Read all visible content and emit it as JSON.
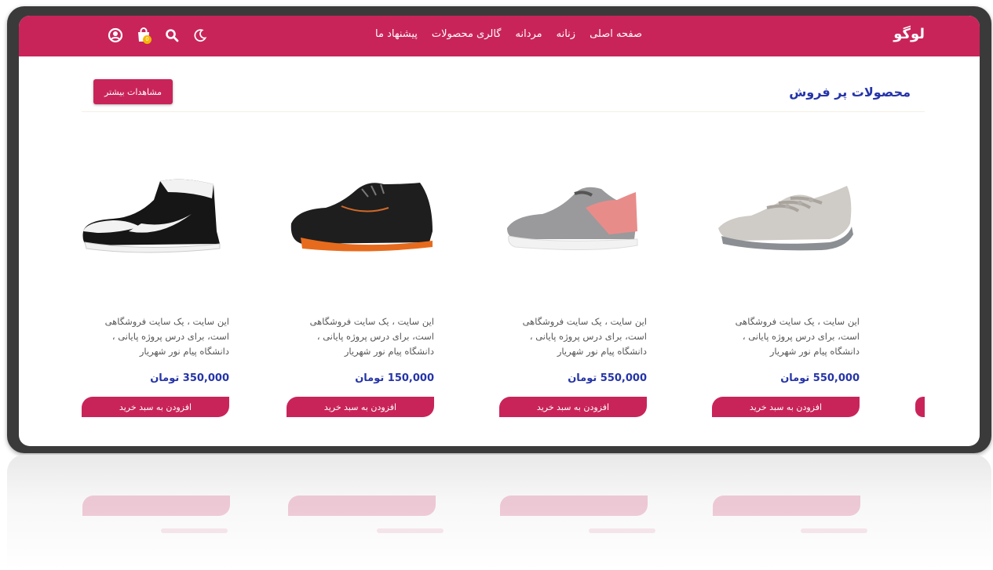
{
  "nav": {
    "logo": "لوگو",
    "links": [
      "صفحه اصلی",
      "زنانه",
      "مردانه",
      "گالری محصولات",
      "پیشنهاد ما"
    ],
    "icons": [
      "account-icon",
      "cart-icon",
      "search-icon",
      "dark-mode-icon"
    ],
    "cart_count": "0",
    "bg_color": "#c9245a"
  },
  "section": {
    "title": "محصولات پر فروش",
    "more_label": "مشاهدات بیشتر"
  },
  "products": [
    {
      "description": "این سایت ، یک سایت فروشگاهی است، برای درس پروژه پایانی ، دانشگاه پیام نور شهریار",
      "price": "550,000 تومان",
      "button": "افزودن به سبد خرید"
    },
    {
      "description": "این سایت ، یک سایت فروشگاهی است، برای درس پروژه پایانی ، دانشگاه پیام نور شهریار",
      "price": "550,000 تومان",
      "button": "افزودن به سبد خرید"
    },
    {
      "description": "این سایت ، یک سایت فروشگاهی است، برای درس پروژه پایانی ، دانشگاه پیام نور شهریار",
      "price": "150,000 تومان",
      "button": "افزودن به سبد خرید"
    },
    {
      "description": "این سایت ، یک سایت فروشگاهی است، برای درس پروژه پایانی ، دانشگاه پیام نور شهریار",
      "price": "350,000 تومان",
      "button": "افزودن به سبد خرید"
    }
  ],
  "colors": {
    "accent": "#c9245a",
    "title": "#2534a8",
    "price": "#2534a8"
  }
}
